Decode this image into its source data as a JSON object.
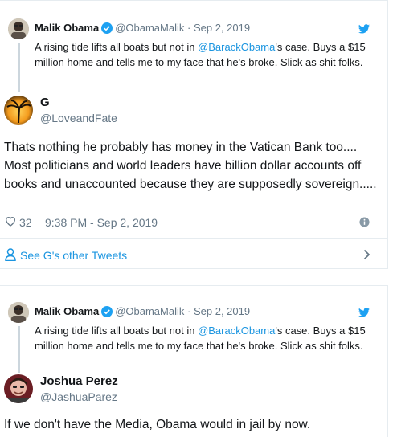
{
  "quoted_tweet": {
    "name": "Malik Obama",
    "handle": "@ObamaMalik",
    "separator": "·",
    "date": "Sep 2, 2019",
    "text_before": "A rising tide lifts all boats but not in ",
    "mention": "@BarackObama",
    "text_after": "'s case. Buys a $15 million home and tells me to my face that he's broke. Slick as shit folks."
  },
  "reply_1": {
    "name": "G",
    "handle": "@LoveandFate",
    "text": "Thats nothing he probably has money in the Vatican Bank too.... Most politicians and world leaders have billion dollar accounts off books and unaccounted because they are supposedly sovereign.....",
    "likes": "32",
    "timestamp": "9:38 PM - Sep 2, 2019",
    "other_tweets_label": "See G's other Tweets"
  },
  "reply_2": {
    "name": "Joshua Perez",
    "handle": "@JashuaParez",
    "text": "If we don't have the Media, Obama would in jail by now."
  },
  "colors": {
    "link": "#1b95e0",
    "secondary_text": "#657786",
    "verified": "#1da1f2",
    "border": "#e6ecf0"
  },
  "icons": [
    "verified-badge-icon",
    "twitter-bird-icon",
    "heart-icon",
    "info-icon",
    "person-icon",
    "chevron-right-icon"
  ]
}
